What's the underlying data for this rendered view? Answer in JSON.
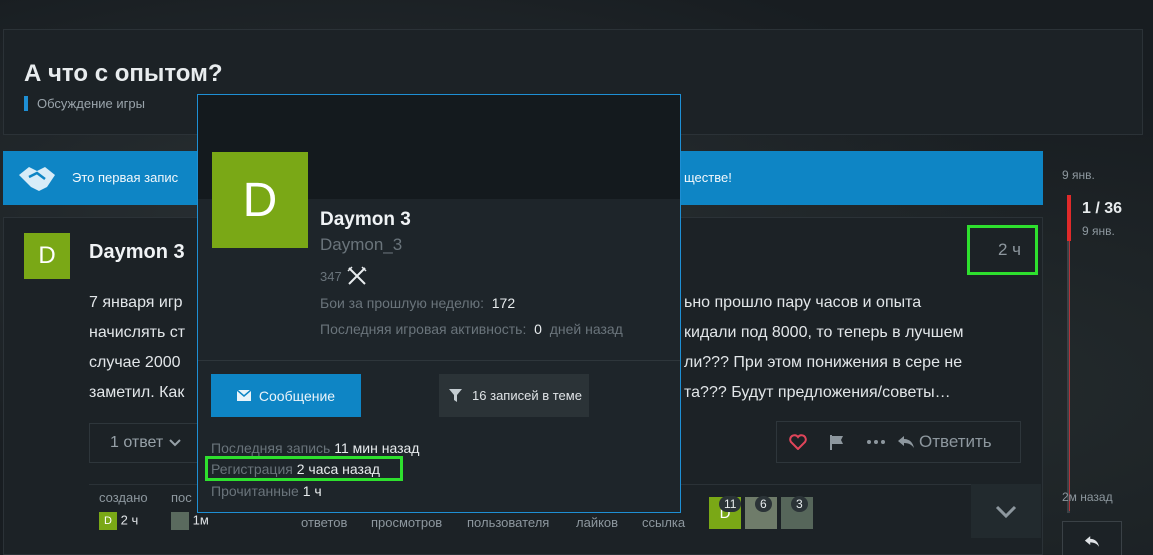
{
  "topic": {
    "title": "А что с опытом?",
    "category": "Обсуждение игры"
  },
  "banner": {
    "text_left": "Это первая запис",
    "text_right": "ществе!"
  },
  "post": {
    "author": "Daymon 3",
    "avatar_letter": "D",
    "time": "2 ч",
    "body_lines": [
      {
        "left": "7 января игр",
        "right": "ьно прошло пару часов и опыта"
      },
      {
        "left": "начислять ст",
        "right": " кидали под 8000, то теперь в лучшем"
      },
      {
        "left": "случае 2000 ",
        "right": "ли??? При этом понижения в сере не"
      },
      {
        "left": "заметил. Как",
        "right": "та??? Будут предложения/советы…"
      }
    ],
    "replies_label": "1 ответ",
    "reply_action": "Ответить"
  },
  "footer": {
    "created_label": "создано",
    "created_value": "2 ч",
    "last_label": "пос",
    "last_value": "1м",
    "answers_label": "ответов",
    "views_label": "просмотров",
    "users_label": "пользователя",
    "likes_label": "лайков",
    "links_label": "ссылка",
    "user_badges": [
      {
        "count": "11"
      },
      {
        "count": "6"
      },
      {
        "count": "3"
      }
    ]
  },
  "timeline": {
    "date_top": "9 янв.",
    "position": "1 / 36",
    "date": "9 янв.",
    "ago": "2м назад"
  },
  "usercard": {
    "avatar_letter": "D",
    "name": "Daymon 3",
    "username": "Daymon_3",
    "rating": "347",
    "battles_label": "Бои за прошлую неделю:",
    "battles_value": "172",
    "activity_label": "Последняя игровая активность:",
    "activity_value": "0",
    "activity_suffix": "дней назад",
    "message_button": "Сообщение",
    "posts_button": "16 записей в теме",
    "last_post_label": "Последняя запись",
    "last_post_value": "11 мин назад",
    "registered_label": "Регистрация",
    "registered_value": "2 часа назад",
    "read_label": "Прочитанные",
    "read_value": "1 ч"
  },
  "colors": {
    "accent": "#0e85c5",
    "avatar": "#7aa816",
    "highlight": "#2ee02e",
    "timeline": "#e02a2a"
  }
}
